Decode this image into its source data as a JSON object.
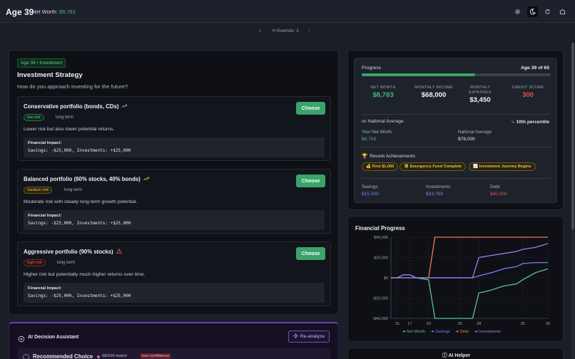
{
  "header": {
    "age": "Age 39",
    "net_worth_label": "Net Worth:",
    "net_worth_value": "$8,783",
    "icons": [
      "gear-icon",
      "moon-icon",
      "refresh-icon",
      "home-icon"
    ]
  },
  "rewind": {
    "prev": "‹",
    "label": "⟲ Rewinds: 3",
    "next": "›"
  },
  "decision": {
    "badge": "Age 39 • Investment",
    "title": "Investment Strategy",
    "question": "How do you approach investing for the future?",
    "options": [
      {
        "title": "Conservative portfolio (bonds, CDs)",
        "risk": "low risk",
        "term": "long term",
        "description": "Lower risk but also lower potential returns.",
        "impact_label": "Financial Impact:",
        "impact": "Savings: -$25,000, Investments: +$25,000",
        "button": "Choose"
      },
      {
        "title": "Balanced portfolio (60% stocks, 40% bonds)",
        "risk": "medium risk",
        "term": "long term",
        "description": "Moderate risk with steady long-term growth potential.",
        "impact_label": "Financial Impact:",
        "impact": "Savings: -$25,000, Investments: +$25,000",
        "button": "Choose"
      },
      {
        "title": "Aggressive portfolio (90% stocks)",
        "risk": "high risk",
        "term": "long term",
        "description": "Higher risk but potentially much higher returns over time.",
        "impact_label": "Financial Impact:",
        "impact": "Savings: -$25,000, Investments: +$25,000",
        "button": "Choose"
      }
    ]
  },
  "ai": {
    "title": "AI Decision Assistant",
    "reanalyze": "Re-analyze",
    "recommended": "Recommended Choice",
    "match": "58/100 match",
    "confidence": "low confidence"
  },
  "progress": {
    "label": "Progress",
    "age_label": "Age 39 of 65",
    "fraction": 0.6,
    "stats": [
      {
        "label": "NET WORTH",
        "value": "$8,783",
        "color": "#4fb37c"
      },
      {
        "label": "MONTHLY INCOME",
        "value": "$68,000",
        "color": "#f2f3f6"
      },
      {
        "label": "MONTHLY EXPENSES",
        "value": "$3,450",
        "color": "#f2f3f6"
      },
      {
        "label": "CREDIT SCORE",
        "value": "300",
        "color": "#e05252"
      }
    ],
    "vs_label": "vs National Average",
    "percentile": "10th percentile",
    "your_label": "Your Net Worth",
    "your_value": "$8,783",
    "nat_label": "National Average",
    "nat_value": "$76,000",
    "achievements_title": "Recent Achievements",
    "achievements": [
      "💰 First $1,000",
      "🛡 Emergency Fund Complete",
      "📈 Investment Journey Begins"
    ],
    "balances": [
      {
        "label": "Savings",
        "value": "$15,000",
        "color": "#7a82f0"
      },
      {
        "label": "Investments",
        "value": "$33,783",
        "color": "#a77ae8"
      },
      {
        "label": "Debt",
        "value": "$40,000",
        "color": "#e05252"
      }
    ]
  },
  "chart_title": "Financial Progress",
  "helper": "ⓘ AI Helper",
  "chart_data": {
    "type": "line",
    "title": "Financial Progress",
    "xlabel": "",
    "ylabel": "",
    "xlim": [
      14,
      39
    ],
    "ylim": [
      -40000,
      40000
    ],
    "x_ticks": [
      15,
      17,
      20,
      25,
      28,
      35,
      39
    ],
    "y_ticks": [
      "$40,000",
      "$20,000",
      "$0",
      "-$20,000",
      "-$40,000"
    ],
    "y_tick_values": [
      40000,
      20000,
      0,
      -20000,
      -40000
    ],
    "grid": true,
    "legend": "bottom",
    "series": [
      {
        "name": "Net Worth",
        "color": "#5cc48a",
        "points": [
          [
            14,
            0
          ],
          [
            15,
            0
          ],
          [
            16,
            3000
          ],
          [
            17,
            3000
          ],
          [
            18,
            0
          ],
          [
            20,
            -2000
          ],
          [
            21,
            -40000
          ],
          [
            27,
            -40000
          ],
          [
            28,
            -15000
          ],
          [
            30,
            -12000
          ],
          [
            32,
            -8000
          ],
          [
            34,
            -6000
          ],
          [
            35,
            -2000
          ],
          [
            37,
            5000
          ],
          [
            39,
            8783
          ]
        ]
      },
      {
        "name": "Savings",
        "color": "#7a82f0",
        "points": [
          [
            14,
            0
          ],
          [
            15,
            0
          ],
          [
            16,
            3000
          ],
          [
            17,
            3000
          ],
          [
            18,
            0
          ],
          [
            20,
            0
          ],
          [
            27,
            0
          ],
          [
            28,
            2000
          ],
          [
            30,
            5000
          ],
          [
            32,
            9000
          ],
          [
            34,
            11000
          ],
          [
            35,
            14000
          ],
          [
            37,
            15000
          ],
          [
            39,
            15000
          ]
        ]
      },
      {
        "name": "Debt",
        "color": "#f07a4a",
        "points": [
          [
            14,
            0
          ],
          [
            20,
            0
          ],
          [
            21,
            40000
          ],
          [
            39,
            40000
          ]
        ]
      },
      {
        "name": "Investments",
        "color": "#a77ae8",
        "points": [
          [
            14,
            0
          ],
          [
            27,
            0
          ],
          [
            28,
            20000
          ],
          [
            30,
            22000
          ],
          [
            32,
            24000
          ],
          [
            34,
            26000
          ],
          [
            35,
            28000
          ],
          [
            37,
            30000
          ],
          [
            39,
            33783
          ]
        ]
      }
    ]
  }
}
